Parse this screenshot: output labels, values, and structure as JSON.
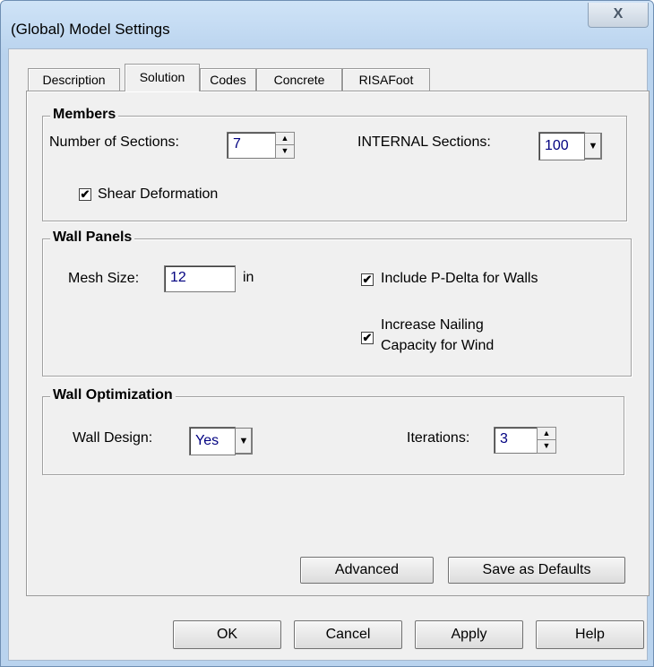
{
  "window": {
    "title": "(Global) Model Settings",
    "close_label": "X"
  },
  "tabs": [
    {
      "label": "Description"
    },
    {
      "label": "Solution",
      "active": true
    },
    {
      "label": "Codes"
    },
    {
      "label": "Concrete"
    },
    {
      "label": "RISAFoot"
    }
  ],
  "members": {
    "title": "Members",
    "sections_label": "Number of Sections:",
    "sections_value": "7",
    "internal_label": "INTERNAL Sections:",
    "internal_value": "100",
    "shear_label": "Shear Deformation",
    "shear_checked": true
  },
  "wall_panels": {
    "title": "Wall Panels",
    "mesh_label": "Mesh Size:",
    "mesh_value": "12",
    "mesh_unit": "in",
    "pdelta_label": "Include P-Delta for Walls",
    "pdelta_checked": true,
    "nailing_label_1": "Increase Nailing",
    "nailing_label_2": "Capacity for Wind",
    "nailing_checked": true
  },
  "wall_optimization": {
    "title": "Wall Optimization",
    "design_label": "Wall Design:",
    "design_value": "Yes",
    "iterations_label": "Iterations:",
    "iterations_value": "3"
  },
  "panel_buttons": {
    "advanced": "Advanced",
    "save_defaults": "Save as Defaults"
  },
  "footer_buttons": {
    "ok": "OK",
    "cancel": "Cancel",
    "apply": "Apply",
    "help": "Help"
  },
  "icons": {
    "check": "✔",
    "spin_up": "▲",
    "spin_down": "▼",
    "dropdown": "▼"
  }
}
